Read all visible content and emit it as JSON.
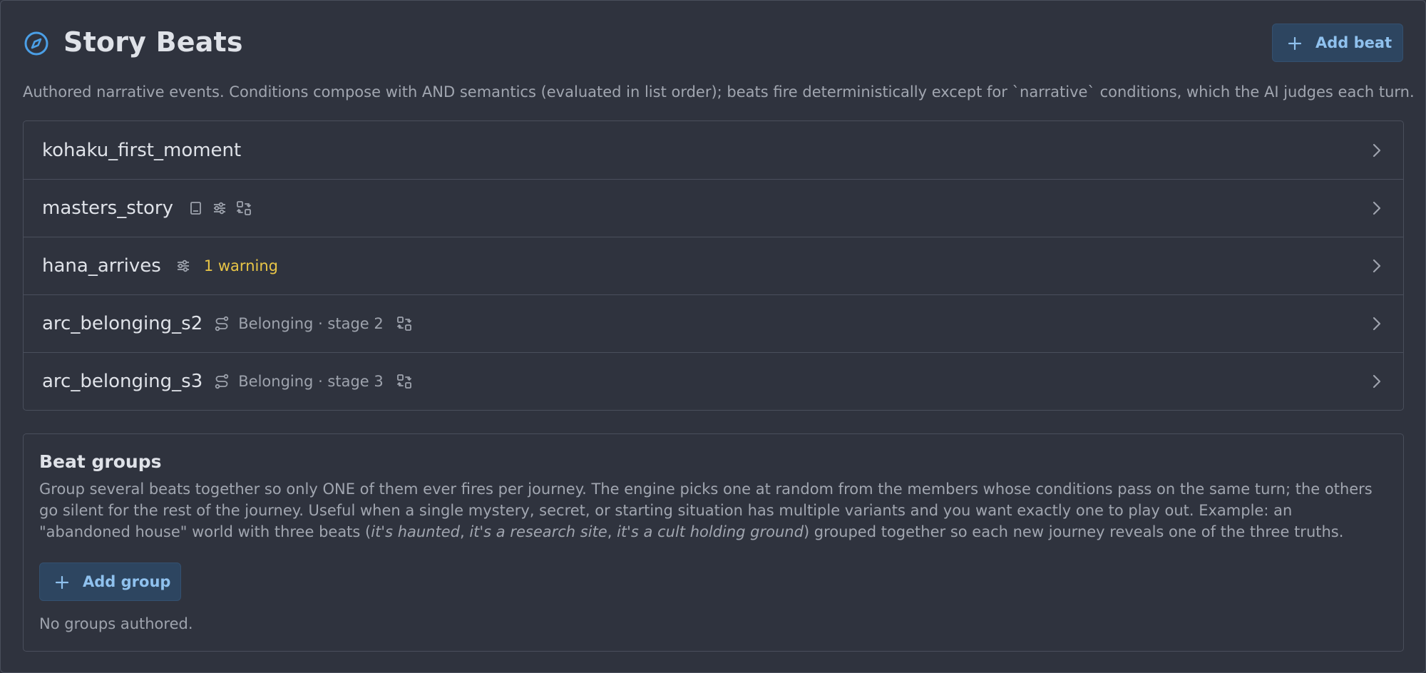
{
  "header": {
    "title": "Story Beats",
    "icon": "compass-icon",
    "add_beat_label": "Add beat",
    "subtitle": "Authored narrative events. Conditions compose with AND semantics (evaluated in list order); beats fire deterministically except for `narrative` conditions, which the AI judges each turn."
  },
  "beats": [
    {
      "name": "kohaku_first_moment",
      "icons": [],
      "arc": "",
      "warning": ""
    },
    {
      "name": "masters_story",
      "icons": [
        "book-icon",
        "sliders-icon",
        "swap-icon"
      ],
      "arc": "",
      "warning": ""
    },
    {
      "name": "hana_arrives",
      "icons": [
        "sliders-icon"
      ],
      "arc": "",
      "warning": "1 warning"
    },
    {
      "name": "arc_belonging_s2",
      "icons": [
        "route-icon",
        "swap-icon"
      ],
      "arc": "Belonging · stage 2",
      "warning": ""
    },
    {
      "name": "arc_belonging_s3",
      "icons": [
        "route-icon",
        "swap-icon"
      ],
      "arc": "Belonging · stage 3",
      "warning": ""
    }
  ],
  "groups": {
    "title": "Beat groups",
    "desc_part1": "Group several beats together so only ONE of them ever fires per journey. The engine picks one at random from the members whose conditions pass on the same turn; the others go silent for the rest of the journey. Useful when a single mystery, secret, or starting situation has multiple variants and you want exactly one to play out. Example: an \"abandoned house\" world with three beats (",
    "example_1": "it's haunted",
    "sep_1": ", ",
    "example_2": "it's a research site",
    "sep_2": ", ",
    "example_3": "it's a cult holding ground",
    "desc_part2": ") grouped together so each new journey reveals one of the three truths.",
    "add_group_label": "Add group",
    "empty_text": "No groups authored."
  },
  "colors": {
    "background": "#2f333e",
    "accent": "#8fc1ee",
    "warning": "#e8c547",
    "button_bg": "#2d4560"
  }
}
